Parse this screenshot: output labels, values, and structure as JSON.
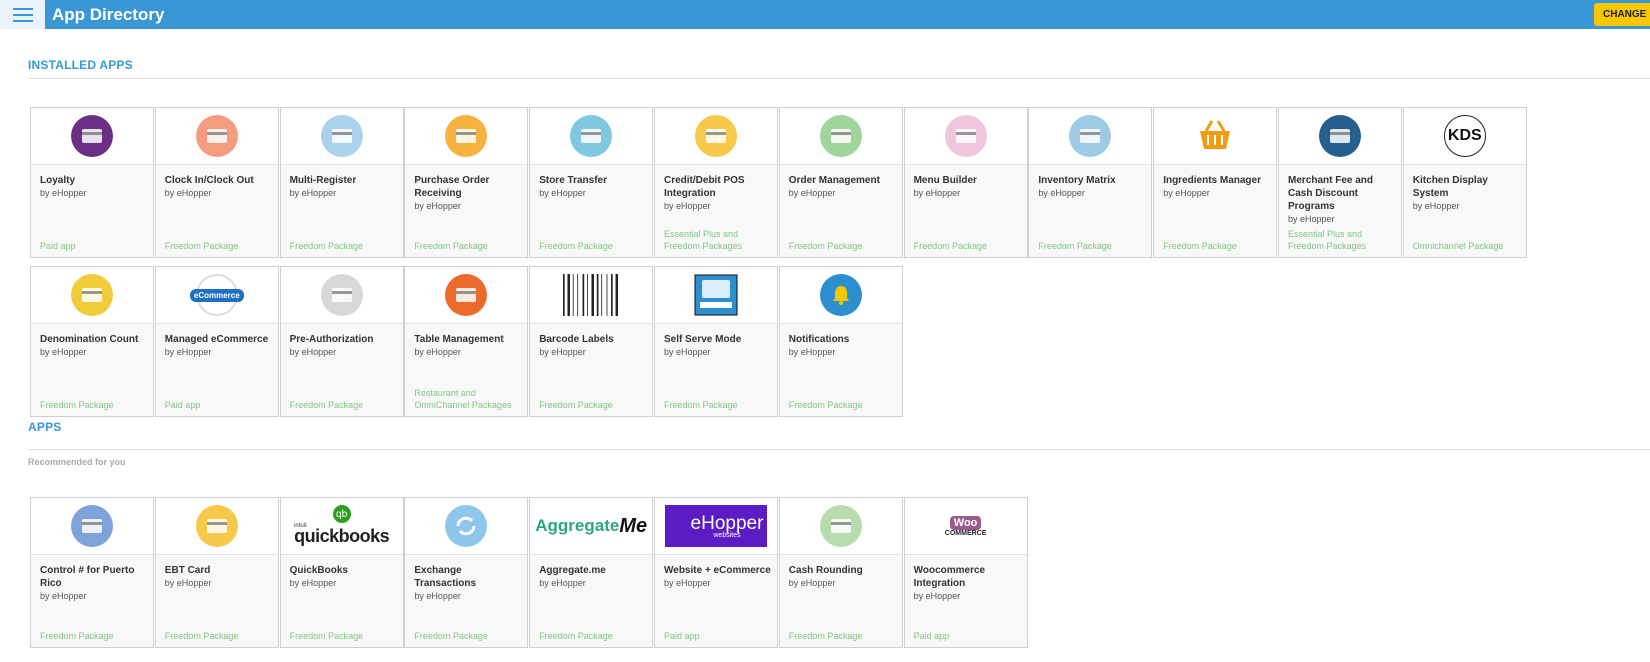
{
  "header": {
    "title": "App Directory",
    "change_label": "CHANGE"
  },
  "installed": {
    "title": "INSTALLED APPS",
    "cards": [
      {
        "name": "Loyalty",
        "by": "by eHopper",
        "package": "Paid app",
        "icon": "loyalty-icon",
        "color": "#6b2f86"
      },
      {
        "name": "Clock In/Clock Out",
        "by": "by eHopper",
        "package": "Freedom Package",
        "icon": "clock-icon",
        "color": "#f39c80"
      },
      {
        "name": "Multi-Register",
        "by": "by eHopper",
        "package": "Freedom Package",
        "icon": "cash-register-icon",
        "color": "#a9d3ec"
      },
      {
        "name": "Purchase Order Receiving",
        "by": "by eHopper",
        "package": "Freedom Package",
        "icon": "hand-truck-icon",
        "color": "#f6b33f"
      },
      {
        "name": "Store Transfer",
        "by": "by eHopper",
        "package": "Freedom Package",
        "icon": "store-icon",
        "color": "#7fc8df"
      },
      {
        "name": "Credit/Debit POS Integration",
        "by": "by eHopper",
        "package": "Essential Plus and Freedom Packages",
        "icon": "credit-card-icon",
        "color": "#f7c94a"
      },
      {
        "name": "Order Management",
        "by": "by eHopper",
        "package": "Freedom Package",
        "icon": "delivery-truck-icon",
        "color": "#9fd49a"
      },
      {
        "name": "Menu Builder",
        "by": "by eHopper",
        "package": "Freedom Package",
        "icon": "menu-grid-icon",
        "color": "#f0c6dc"
      },
      {
        "name": "Inventory Matrix",
        "by": "by eHopper",
        "package": "Freedom Package",
        "icon": "inventory-matrix-icon",
        "color": "#9dcbe6"
      },
      {
        "name": "Ingredients Manager",
        "by": "by eHopper",
        "package": "Freedom Package",
        "icon": "basket-icon",
        "color": "#f39c12"
      },
      {
        "name": "Merchant Fee and Cash Discount Programs",
        "by": "by eHopper",
        "package": "Essential Plus and Freedom Packages",
        "icon": "hand-card-icon",
        "color": "#245f8e"
      },
      {
        "name": "Kitchen Display System",
        "by": "by eHopper",
        "package": "Omnichannel Package",
        "icon": "kds-icon",
        "color": "#ffffff",
        "text": "KDS"
      },
      {
        "name": "Denomination Count",
        "by": "by eHopper",
        "package": "Freedom Package",
        "icon": "cash-coins-icon",
        "color": "#f2cc3a"
      },
      {
        "name": "Managed eCommerce",
        "by": "by eHopper",
        "package": "Paid app",
        "icon": "ecommerce-bubble-icon",
        "color": "#ffffff",
        "text": "eCommerce"
      },
      {
        "name": "Pre-Authorization",
        "by": "by eHopper",
        "package": "Freedom Package",
        "icon": "card-coin-icon",
        "color": "#d8d8d8"
      },
      {
        "name": "Table Management",
        "by": "by eHopper",
        "package": "Restaurant and OmniChannel Packages",
        "icon": "fork-knife-icon",
        "color": "#ec6a2b"
      },
      {
        "name": "Barcode Labels",
        "by": "by eHopper",
        "package": "Freedom Package",
        "icon": "barcode-icon",
        "color": "#222222"
      },
      {
        "name": "Self Serve Mode",
        "by": "by eHopper",
        "package": "Freedom Package",
        "icon": "kiosk-icon",
        "color": "#2e8fd0"
      },
      {
        "name": "Notifications",
        "by": "by eHopper",
        "package": "Freedom Package",
        "icon": "bell-icon",
        "color": "#2e8fd0"
      }
    ]
  },
  "apps": {
    "title": "APPS",
    "subtitle": "Recommended for you",
    "cards": [
      {
        "name": "Control # for Puerto Rico",
        "by": "by eHopper",
        "package": "Freedom Package",
        "icon": "check-document-icon",
        "color": "#7ea3d8"
      },
      {
        "name": "EBT Card",
        "by": "by eHopper",
        "package": "Freedom Package",
        "icon": "ebt-card-icon",
        "color": "#f7c94a"
      },
      {
        "name": "QuickBooks",
        "by": "by eHopper",
        "package": "Freedom Package",
        "icon": "quickbooks-logo",
        "color": "#2ca01c",
        "text": "quickbooks",
        "subtext": "intuit"
      },
      {
        "name": "Exchange Transactions",
        "by": "by eHopper",
        "package": "Freedom Package",
        "icon": "exchange-icon",
        "color": "#8fc6ec"
      },
      {
        "name": "Aggregate.me",
        "by": "by eHopper",
        "package": "Freedom Package",
        "icon": "aggregateme-logo",
        "color": "#2aa87a",
        "text": "Aggregate",
        "subtext": "Me"
      },
      {
        "name": "Website + eCommerce",
        "by": "by eHopper",
        "package": "Paid app",
        "icon": "ehopper-websites-logo",
        "color": "#5b1cc4",
        "text": "eHopper",
        "subtext": "websites"
      },
      {
        "name": "Cash Rounding",
        "by": "by eHopper",
        "package": "Freedom Package",
        "icon": "coins-icon",
        "color": "#b8dcae"
      },
      {
        "name": "Woocommerce Integration",
        "by": "by eHopper",
        "package": "Paid app",
        "icon": "woocommerce-logo",
        "color": "#9a5c8f",
        "text": "Woo",
        "subtext": "COMMERCE"
      }
    ]
  }
}
